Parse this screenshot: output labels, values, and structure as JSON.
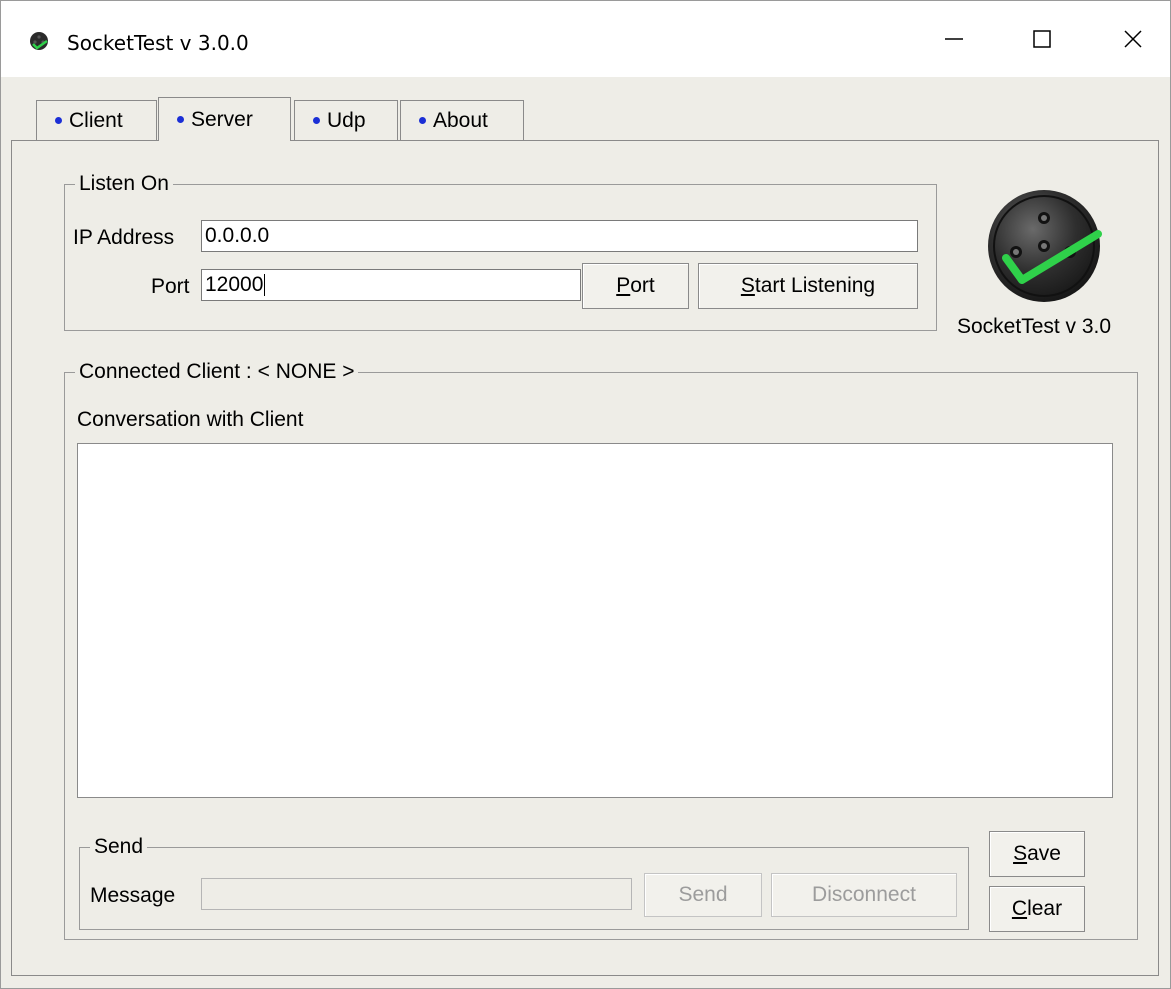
{
  "window": {
    "title": "SocketTest v 3.0.0",
    "icons": {
      "app": "socket-icon",
      "minimize": "minimize-icon",
      "maximize": "maximize-icon",
      "close": "close-icon"
    }
  },
  "tabs": [
    {
      "label": "Client",
      "active": false
    },
    {
      "label": "Server",
      "active": true
    },
    {
      "label": "Udp",
      "active": false
    },
    {
      "label": "About",
      "active": false
    }
  ],
  "listen": {
    "legend": "Listen On",
    "ip_label": "IP Address",
    "ip_value": "0.0.0.0",
    "port_label": "Port",
    "port_value": "12000",
    "port_button_rest": "ort",
    "port_button_mnemonic": "P",
    "start_button_mnemonic": "S",
    "start_button_rest": "tart Listening"
  },
  "logo": {
    "caption": "SocketTest v 3.0",
    "colors": {
      "body": "#2c2c2c",
      "check": "#2fd14a"
    }
  },
  "connection": {
    "legend": "Connected Client : < NONE >",
    "conversation_label": "Conversation with Client"
  },
  "send": {
    "legend": "Send",
    "message_label": "Message",
    "message_value": "",
    "send_button": "Send",
    "disconnect_button": "Disconnect"
  },
  "actions": {
    "save_mnemonic": "S",
    "save_rest": "ave",
    "clear_mnemonic": "C",
    "clear_rest": "lear"
  },
  "colors": {
    "tab_dot": "#1b2fd6",
    "window_bg": "#eeede7"
  }
}
